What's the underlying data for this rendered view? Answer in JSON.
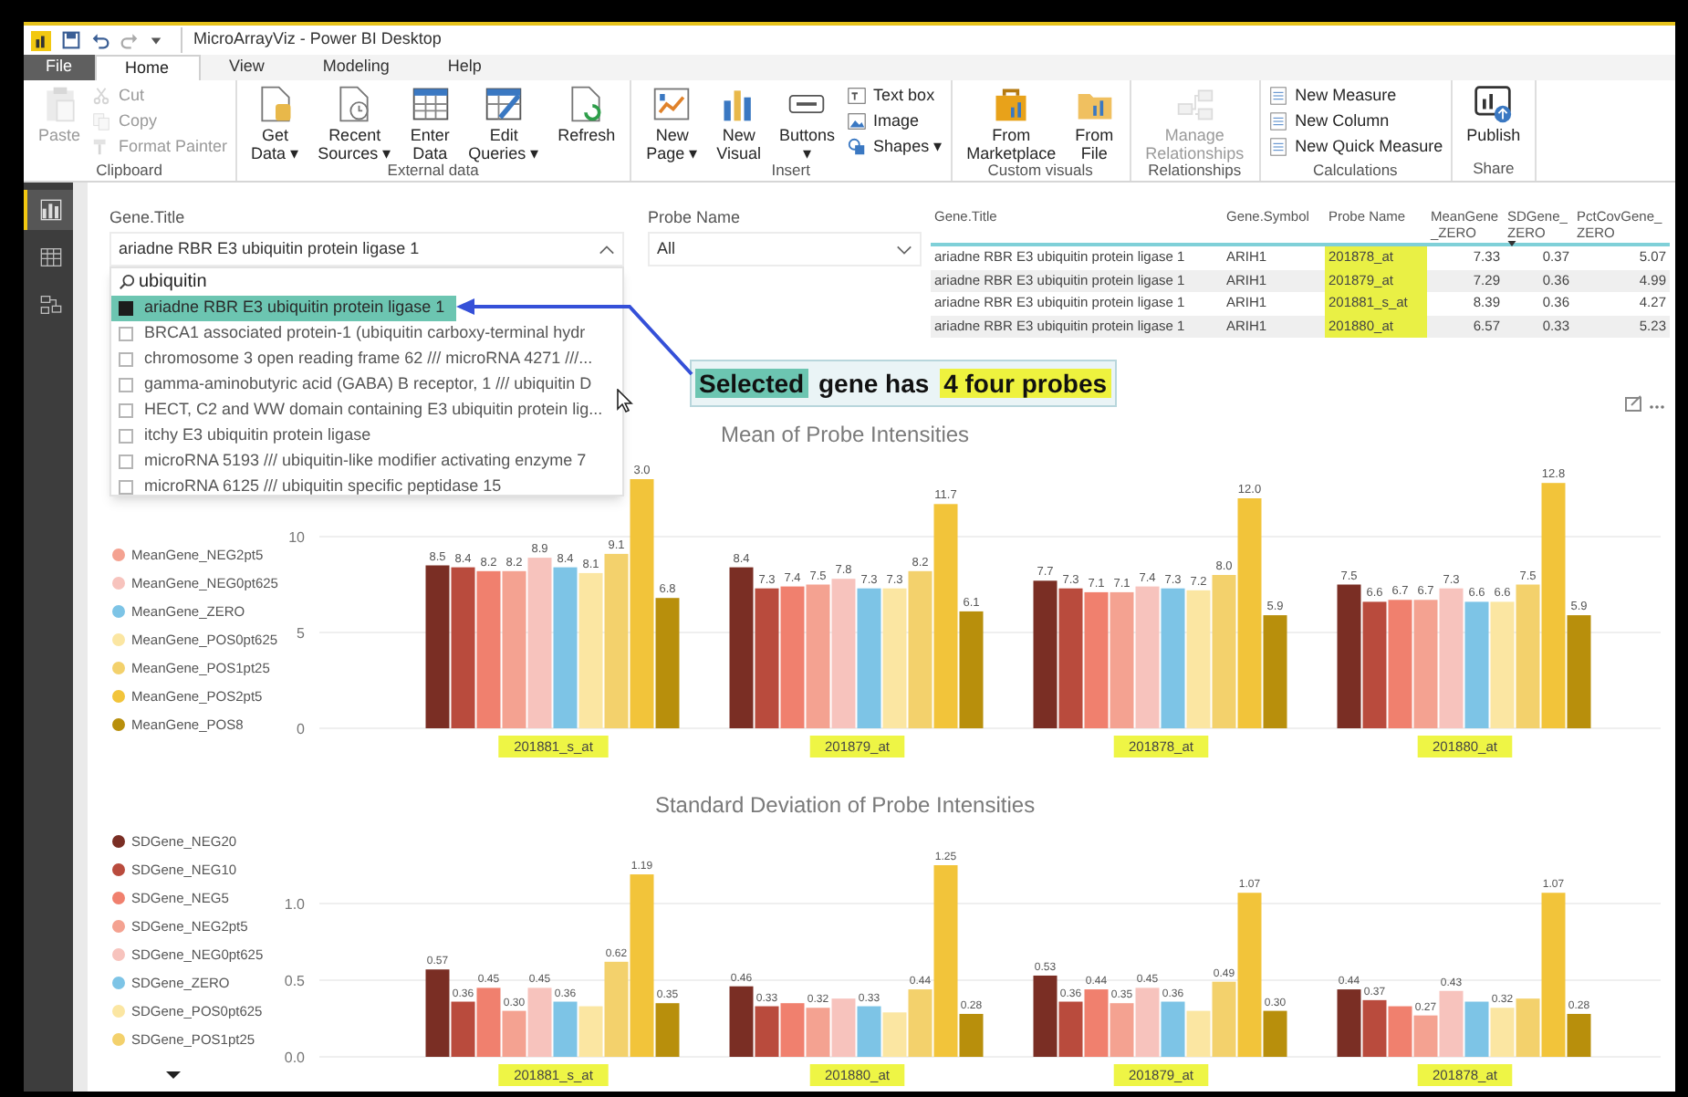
{
  "window": {
    "title": "MicroArrayViz - Power BI Desktop"
  },
  "tabs": [
    {
      "label": "File",
      "kind": "file",
      "selected": false
    },
    {
      "label": "Home",
      "kind": "tab",
      "selected": true
    },
    {
      "label": "View",
      "kind": "tab",
      "selected": false
    },
    {
      "label": "Modeling",
      "kind": "tab",
      "selected": false
    },
    {
      "label": "Help",
      "kind": "tab",
      "selected": false
    }
  ],
  "ribbon": {
    "groups": [
      {
        "label": "Clipboard",
        "items": [
          {
            "kind": "large",
            "lines": [
              "Paste"
            ],
            "disabled": true
          },
          {
            "kind": "stack",
            "items": [
              {
                "label": "Cut",
                "disabled": true
              },
              {
                "label": "Copy",
                "disabled": true
              },
              {
                "label": "Format Painter",
                "disabled": true
              }
            ]
          }
        ]
      },
      {
        "label": "External data",
        "items": [
          {
            "kind": "large",
            "lines": [
              "Get",
              "Data ▾"
            ],
            "disabled": false
          },
          {
            "kind": "large",
            "lines": [
              "Recent",
              "Sources ▾"
            ],
            "disabled": false
          },
          {
            "kind": "large",
            "lines": [
              "Enter",
              "Data"
            ],
            "disabled": false
          },
          {
            "kind": "large",
            "lines": [
              "Edit",
              "Queries ▾"
            ],
            "disabled": false
          },
          {
            "kind": "large",
            "lines": [
              "Refresh"
            ],
            "disabled": false
          }
        ]
      },
      {
        "label": "Insert",
        "items": [
          {
            "kind": "large",
            "lines": [
              "New",
              "Page ▾"
            ],
            "disabled": false
          },
          {
            "kind": "large",
            "lines": [
              "New",
              "Visual"
            ],
            "disabled": false
          },
          {
            "kind": "large",
            "lines": [
              "Buttons",
              "▾"
            ],
            "disabled": false
          },
          {
            "kind": "stack",
            "items": [
              {
                "label": "Text box",
                "disabled": false
              },
              {
                "label": "Image",
                "disabled": false
              },
              {
                "label": "Shapes ▾",
                "disabled": false
              }
            ]
          }
        ]
      },
      {
        "label": "Custom visuals",
        "items": [
          {
            "kind": "large",
            "lines": [
              "From",
              "Marketplace"
            ],
            "disabled": false
          },
          {
            "kind": "large",
            "lines": [
              "From",
              "File"
            ],
            "disabled": false
          }
        ]
      },
      {
        "label": "Relationships",
        "items": [
          {
            "kind": "large",
            "lines": [
              "Manage",
              "Relationships"
            ],
            "disabled": true
          }
        ]
      },
      {
        "label": "Calculations",
        "items": [
          {
            "kind": "stack",
            "items": [
              {
                "label": "New Measure",
                "disabled": false
              },
              {
                "label": "New Column",
                "disabled": false
              },
              {
                "label": "New Quick Measure",
                "disabled": false
              }
            ]
          }
        ]
      },
      {
        "label": "Share",
        "items": [
          {
            "kind": "large",
            "lines": [
              "Publish"
            ],
            "disabled": false
          }
        ]
      }
    ]
  },
  "nav_rail": [
    {
      "selected": true
    },
    {
      "selected": false
    },
    {
      "selected": false
    }
  ],
  "gene_slicer": {
    "title": "Gene.Title",
    "value": "ariadne RBR E3 ubiquitin protein ligase 1",
    "expanded": true,
    "search": "ubiquitin",
    "items": [
      {
        "label": "ariadne RBR E3 ubiquitin protein ligase 1",
        "checked": true,
        "selected": true
      },
      {
        "label": "BRCA1 associated protein-1 (ubiquitin carboxy-terminal hydr",
        "checked": false,
        "selected": false
      },
      {
        "label": "chromosome 3 open reading frame 62 /// microRNA 4271 ///...",
        "checked": false,
        "selected": false
      },
      {
        "label": "gamma-aminobutyric acid (GABA) B receptor, 1 /// ubiquitin D",
        "checked": false,
        "selected": false
      },
      {
        "label": "HECT, C2 and WW domain containing E3 ubiquitin protein lig...",
        "checked": false,
        "selected": false
      },
      {
        "label": "itchy E3 ubiquitin protein ligase",
        "checked": false,
        "selected": false
      },
      {
        "label": "microRNA 5193 /// ubiquitin-like modifier activating enzyme 7",
        "checked": false,
        "selected": false
      },
      {
        "label": "microRNA 6125 /// ubiquitin specific peptidase 15",
        "checked": false,
        "selected": false
      }
    ]
  },
  "probe_slicer": {
    "title": "Probe Name",
    "value": "All",
    "expanded": false
  },
  "table": {
    "columns": [
      {
        "lines": [
          "Gene.Title"
        ],
        "kind": "text",
        "highlighted": false,
        "sorted": false
      },
      {
        "lines": [
          "Gene.Symbol"
        ],
        "kind": "text",
        "highlighted": false,
        "sorted": false
      },
      {
        "lines": [
          "Probe Name"
        ],
        "kind": "text",
        "highlighted": true,
        "sorted": false
      },
      {
        "lines": [
          "MeanGene",
          "_ZERO"
        ],
        "kind": "number",
        "highlighted": false,
        "sorted": false
      },
      {
        "lines": [
          "SDGene_",
          "ZERO"
        ],
        "kind": "number",
        "highlighted": false,
        "sorted": true
      },
      {
        "lines": [
          "PctCovGene_",
          "ZERO"
        ],
        "kind": "number",
        "highlighted": false,
        "sorted": false
      }
    ],
    "rows": [
      [
        "ariadne RBR E3 ubiquitin protein ligase 1",
        "ARIH1",
        "201878_at",
        "7.33",
        "0.37",
        "5.07"
      ],
      [
        "ariadne RBR E3 ubiquitin protein ligase 1",
        "ARIH1",
        "201879_at",
        "7.29",
        "0.36",
        "4.99"
      ],
      [
        "ariadne RBR E3 ubiquitin protein ligase 1",
        "ARIH1",
        "201881_s_at",
        "8.39",
        "0.36",
        "4.27"
      ],
      [
        "ariadne RBR E3 ubiquitin protein ligase 1",
        "ARIH1",
        "201880_at",
        "6.57",
        "0.33",
        "5.23"
      ]
    ]
  },
  "callout": {
    "parts": [
      {
        "text": "Selected",
        "color": "#6cc5b1"
      },
      {
        "text": " gene has "
      },
      {
        "text": "4 four probes",
        "color": "#eef23e"
      }
    ]
  },
  "mean_chart": {
    "chart_data": {
      "type": "bar",
      "title": "Mean of Probe Intensities",
      "categories": [
        "201881_s_at",
        "201879_at",
        "201878_at",
        "201880_at"
      ],
      "yticks": [
        0,
        5,
        10
      ],
      "ylim": [
        0,
        13
      ],
      "legend": true,
      "series": [
        {
          "color": "#7a2e24",
          "values": [
            8.5,
            8.4,
            7.7,
            7.5
          ]
        },
        {
          "color": "#b94b3d",
          "values": [
            8.4,
            7.3,
            7.3,
            6.6
          ]
        },
        {
          "color": "#f0806e",
          "values": [
            8.2,
            7.4,
            7.1,
            6.7
          ]
        },
        {
          "name": "MeanGene_NEG2pt5",
          "color": "#f4a291",
          "values": [
            8.2,
            7.5,
            7.1,
            6.7
          ]
        },
        {
          "name": "MeanGene_NEG0pt625",
          "color": "#f7c3bd",
          "values": [
            8.9,
            7.8,
            7.4,
            7.3
          ]
        },
        {
          "name": "MeanGene_ZERO",
          "color": "#7dc4e6",
          "values": [
            8.4,
            7.3,
            7.3,
            6.6
          ]
        },
        {
          "name": "MeanGene_POS0pt625",
          "color": "#fbe6a2",
          "values": [
            8.1,
            7.3,
            7.2,
            6.6
          ]
        },
        {
          "name": "MeanGene_POS1pt25",
          "color": "#f3d16c",
          "values": [
            9.1,
            8.2,
            8.0,
            7.5
          ]
        },
        {
          "name": "MeanGene_POS2pt5",
          "color": "#f2c43a",
          "values": [
            13.0,
            11.7,
            12.0,
            12.8
          ]
        },
        {
          "name": "MeanGene_POS8",
          "color": "#b88f0c",
          "values": [
            6.8,
            6.1,
            5.9,
            5.9
          ]
        }
      ],
      "value_labels": [
        [
          "8.5",
          "8.4",
          "7.7",
          "7.5"
        ],
        [
          "8.4",
          "7.3",
          "7.3",
          "6.6"
        ],
        [
          "8.2",
          "7.4",
          "7.1",
          "6.7"
        ],
        [
          "8.2",
          "7.5",
          "7.1",
          "6.7"
        ],
        [
          "8.9",
          "7.8",
          "7.4",
          "7.3"
        ],
        [
          "8.4",
          "7.3",
          "7.3",
          "6.6"
        ],
        [
          "8.1",
          "7.3",
          "7.2",
          "6.6"
        ],
        [
          "9.1",
          "8.2",
          "8.0",
          "7.5"
        ],
        [
          "3.0",
          "11.7",
          "12.0",
          "12.8"
        ],
        [
          "6.8",
          "6.1",
          "5.9",
          "5.9"
        ]
      ]
    }
  },
  "sd_chart": {
    "legend_more": true,
    "chart_data": {
      "type": "bar",
      "title": "Standard Deviation of Probe Intensities",
      "categories": [
        "201881_s_at",
        "201880_at",
        "201879_at",
        "201878_at"
      ],
      "yticks": [
        {
          "value": 0,
          "label": "0.0"
        },
        {
          "value": 0.5,
          "label": "0.5"
        },
        {
          "value": 1,
          "label": "1.0"
        }
      ],
      "ylim": [
        0,
        1.25
      ],
      "legend": true,
      "series": [
        {
          "name": "SDGene_NEG20",
          "color": "#7a2e24",
          "values": [
            0.57,
            0.46,
            0.53,
            0.44
          ]
        },
        {
          "name": "SDGene_NEG10",
          "color": "#b94b3d",
          "values": [
            0.36,
            0.33,
            0.36,
            0.37
          ]
        },
        {
          "name": "SDGene_NEG5",
          "color": "#f0806e",
          "values": [
            0.45,
            0.35,
            0.44,
            0.33
          ]
        },
        {
          "name": "SDGene_NEG2pt5",
          "color": "#f4a291",
          "values": [
            0.3,
            0.32,
            0.35,
            0.27
          ]
        },
        {
          "name": "SDGene_NEG0pt625",
          "color": "#f7c3bd",
          "values": [
            0.45,
            0.38,
            0.45,
            0.43
          ]
        },
        {
          "name": "SDGene_ZERO",
          "color": "#7dc4e6",
          "values": [
            0.36,
            0.33,
            0.36,
            0.36
          ]
        },
        {
          "name": "SDGene_POS0pt625",
          "color": "#fbe6a2",
          "values": [
            0.33,
            0.29,
            0.3,
            0.32
          ]
        },
        {
          "name": "SDGene_POS1pt25",
          "color": "#f3d16c",
          "values": [
            0.62,
            0.44,
            0.49,
            0.38
          ]
        },
        {
          "color": "#f2c43a",
          "values": [
            1.19,
            1.25,
            1.07,
            1.07
          ]
        },
        {
          "color": "#b88f0c",
          "values": [
            0.35,
            0.28,
            0.3,
            0.28
          ]
        }
      ],
      "value_labels": [
        [
          "0.57",
          "0.46",
          "0.53",
          "0.44"
        ],
        [
          "0.36",
          "0.33",
          "0.36",
          "0.37"
        ],
        [
          "0.45",
          null,
          "0.44",
          null
        ],
        [
          "0.30",
          "0.32",
          "0.35",
          "0.27"
        ],
        [
          "0.45",
          null,
          "0.45",
          "0.43"
        ],
        [
          "0.36",
          "0.33",
          "0.36",
          null
        ],
        [
          null,
          null,
          null,
          "0.32"
        ],
        [
          "0.62",
          "0.44",
          "0.49",
          null
        ],
        [
          "1.19",
          "1.25",
          "1.07",
          "1.07"
        ],
        [
          "0.35",
          "0.28",
          "0.30",
          "0.28"
        ]
      ]
    }
  }
}
